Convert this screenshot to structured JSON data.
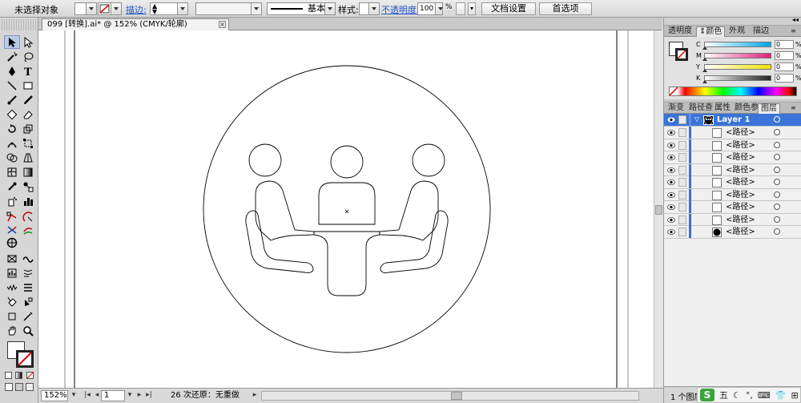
{
  "control_bar": {
    "selection_status": "未选择对象",
    "stroke_label": "描边:",
    "stroke_style": "基本",
    "style_label": "样式:",
    "opacity_label": "不透明度:",
    "opacity_value": "100",
    "percent_symbol": "%",
    "doc_setup_button": "文档设置",
    "prefs_button": "首选项"
  },
  "document": {
    "tab_title": "099 [转换].ai* @ 152% (CMYK/轮廓)",
    "close_glyph": "×"
  },
  "status_bar": {
    "zoom": "152%",
    "artboard": "1",
    "undo_status": "26 次还原：无重做"
  },
  "color_panel": {
    "tabs": [
      "透明度",
      "颜色",
      "外观",
      "描边"
    ],
    "active_tab": "颜色",
    "channels": [
      {
        "letter": "C",
        "value": "0",
        "color": "#00a8e8"
      },
      {
        "letter": "M",
        "value": "0",
        "color": "#e0207a"
      },
      {
        "letter": "Y",
        "value": "0",
        "color": "#f2e100"
      },
      {
        "letter": "K",
        "value": "0",
        "color": "#222222"
      }
    ],
    "percent": "%"
  },
  "layers_panel": {
    "tabs": [
      "渐变",
      "路径查",
      "属性",
      "颜色参",
      "图层"
    ],
    "active_tab": "图层",
    "layer_name": "Layer 1",
    "paths": [
      "<路径>",
      "<路径>",
      "<路径>",
      "<路径>",
      "<路径>",
      "<路径>",
      "<路径>",
      "<路径>",
      "<路径>"
    ],
    "footer": "1 个图层"
  },
  "ime_bar": {
    "logo": "S",
    "mode": "五",
    "items": [
      "☾",
      "°,",
      "⌨",
      "👕",
      "⊞"
    ]
  },
  "colors": {
    "accent": "#3b74d8",
    "layer_color": "#3b6fe0"
  }
}
